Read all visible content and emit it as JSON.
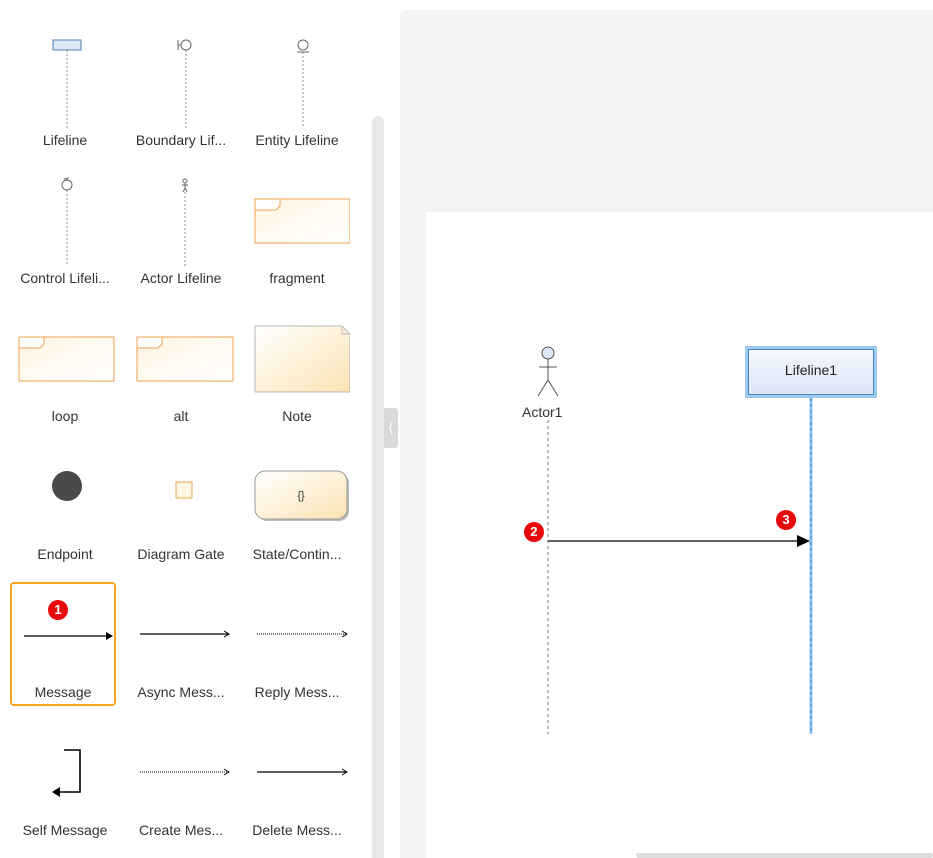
{
  "palette": {
    "items": [
      {
        "label": "Lifeline"
      },
      {
        "label": "Boundary Lif..."
      },
      {
        "label": "Entity Lifeline"
      },
      {
        "label": "Control Lifeli..."
      },
      {
        "label": "Actor Lifeline"
      },
      {
        "label": "fragment"
      },
      {
        "label": "loop"
      },
      {
        "label": "alt"
      },
      {
        "label": "Note"
      },
      {
        "label": "Endpoint"
      },
      {
        "label": "Diagram Gate"
      },
      {
        "label": "State/Contin..."
      },
      {
        "label": "Message"
      },
      {
        "label": "Async Mess..."
      },
      {
        "label": "Reply Mess..."
      },
      {
        "label": "Self Message"
      },
      {
        "label": "Create Mes..."
      },
      {
        "label": "Delete Mess..."
      }
    ],
    "state_symbol": "{}",
    "selected": "Message"
  },
  "diagram": {
    "actor_name": "Actor1",
    "lifeline_name": "Lifeline1"
  },
  "annotations": {
    "badge1": "1",
    "badge2": "2",
    "badge3": "3"
  },
  "colors": {
    "selection": "#f5a623",
    "badge": "#e8070a",
    "lifeline_border": "#9ccbf0",
    "fragment_border": "#f0a050"
  }
}
